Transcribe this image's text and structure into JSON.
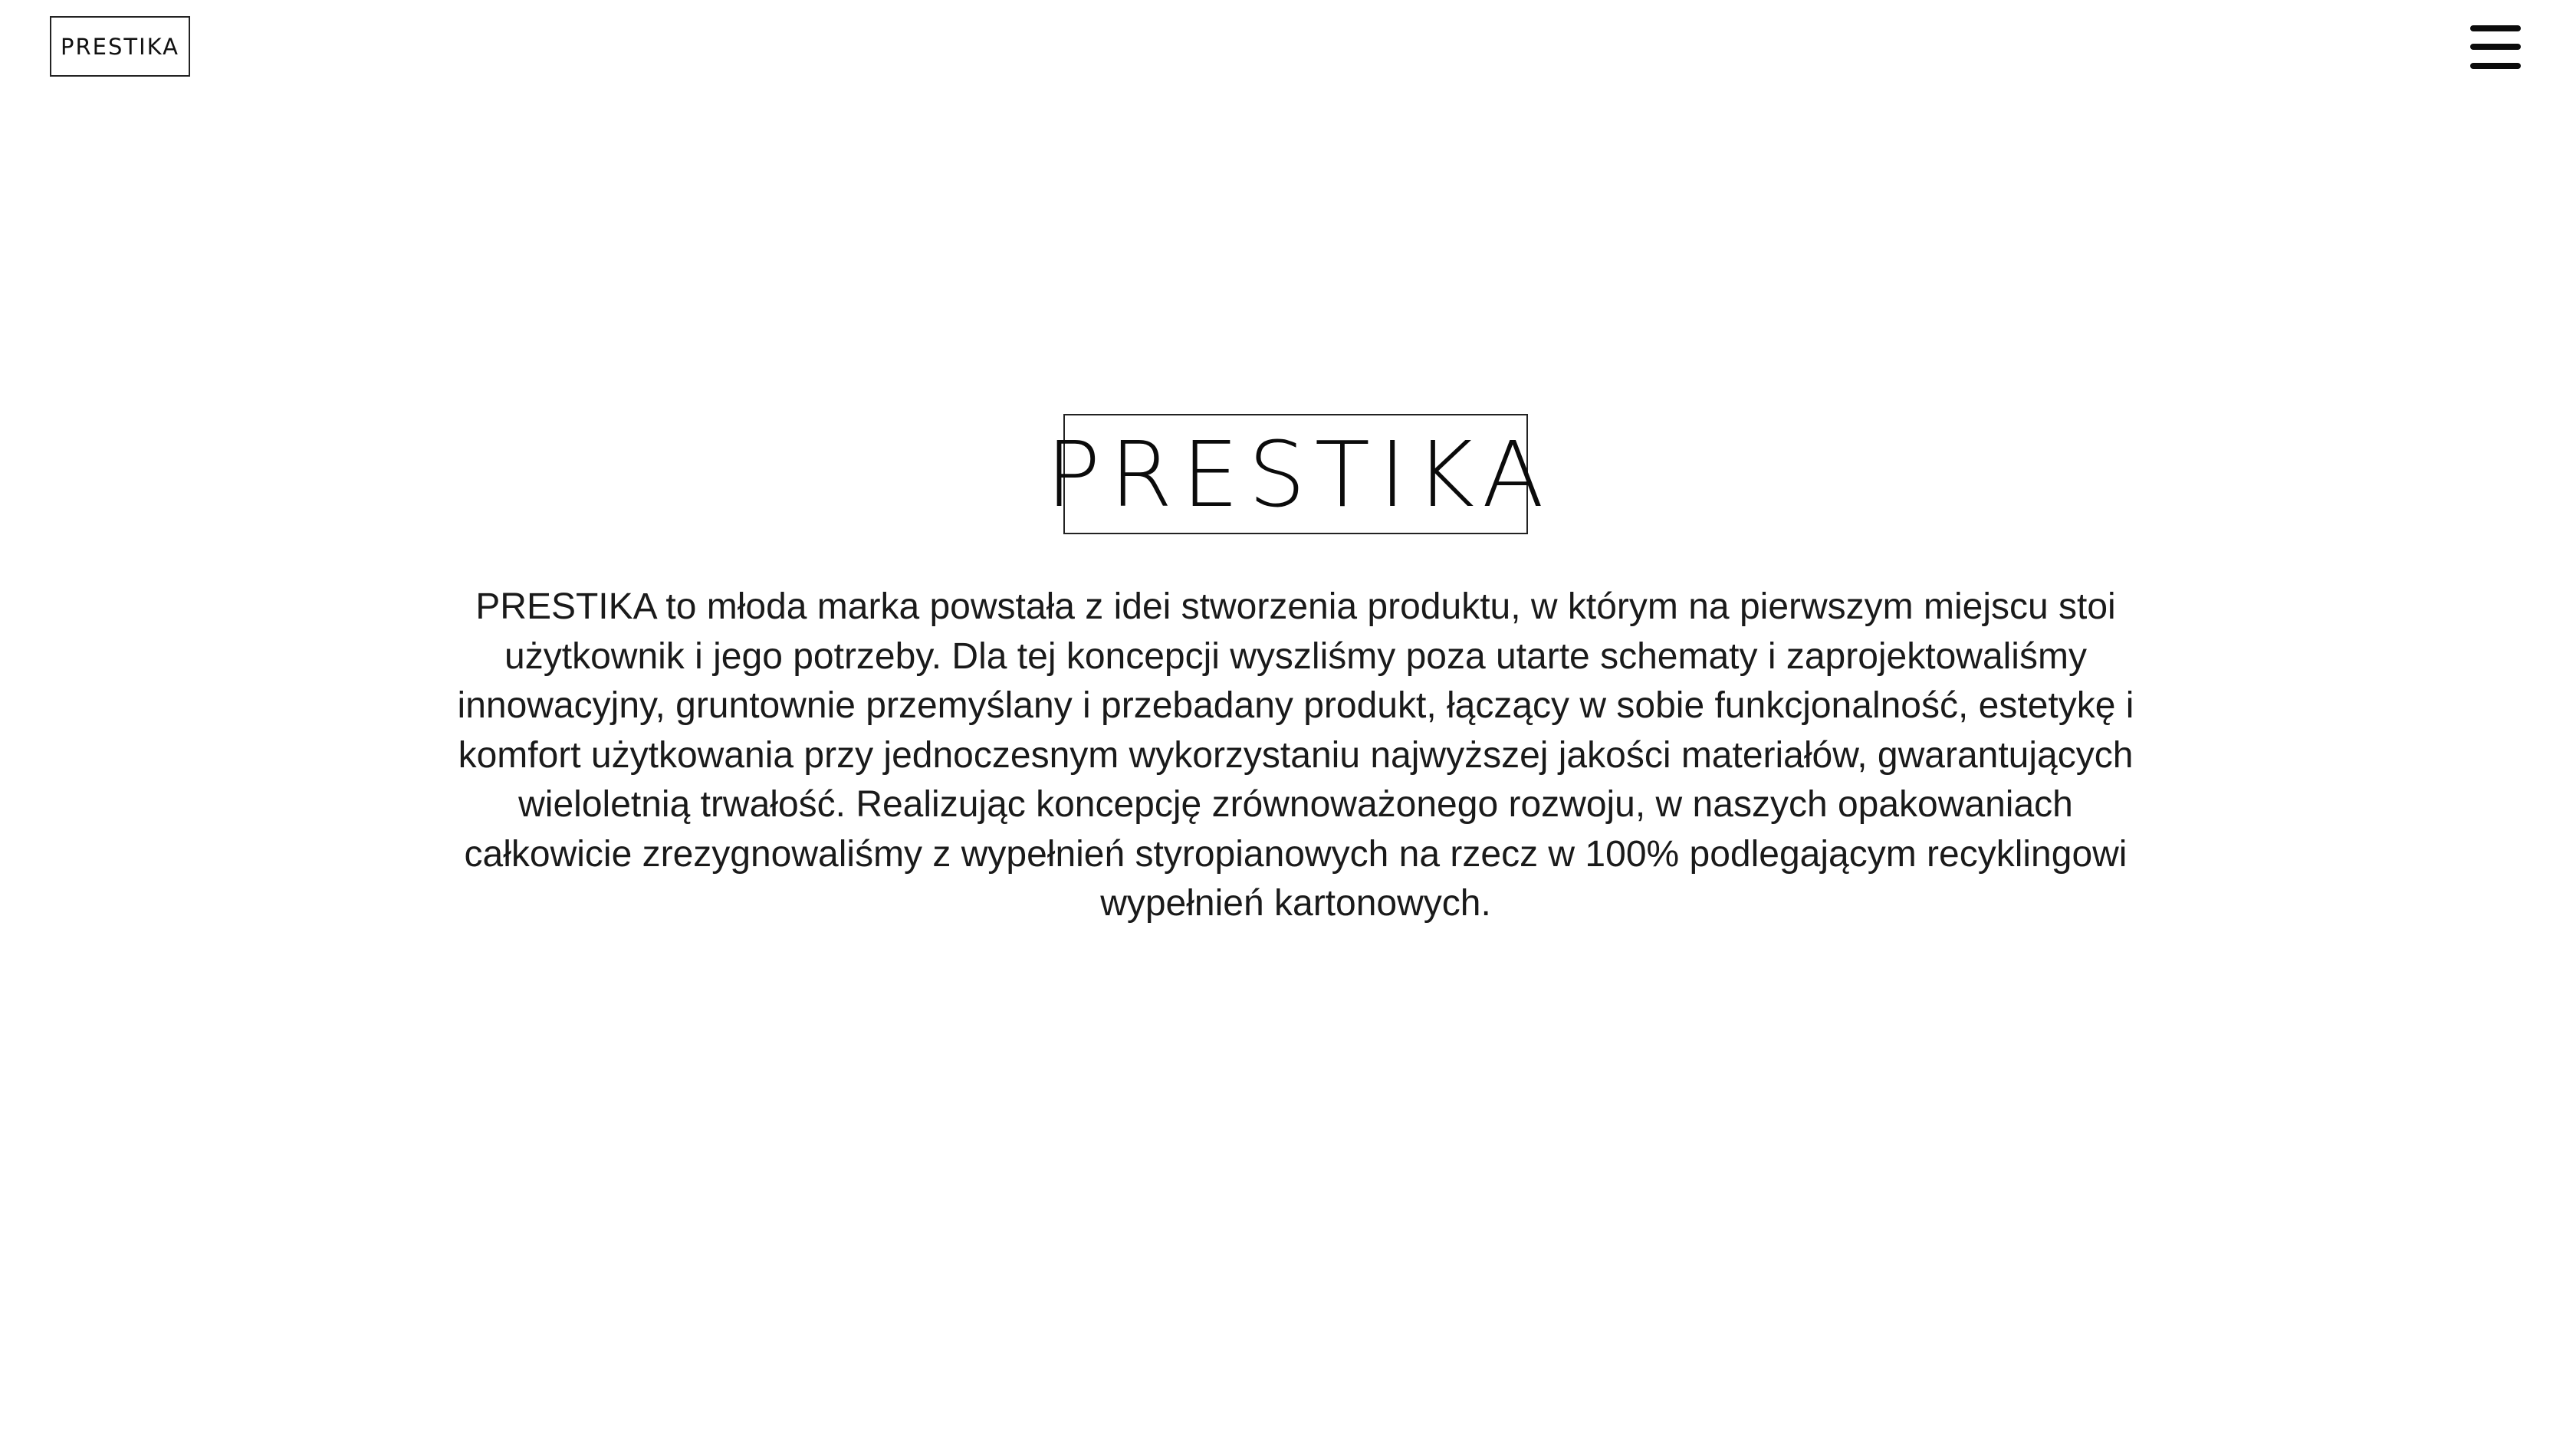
{
  "header": {
    "logo_text": "PRESTIKA",
    "menu_icon": "hamburger-menu-icon"
  },
  "hero": {
    "logo_text": "PRESTIKA",
    "description": "PRESTIKA to młoda marka powstała z idei stworzenia produktu, w którym na pierwszym miejscu stoi użytkownik i jego potrzeby. Dla tej koncepcji wyszliśmy poza utarte schematy i zaprojektowaliśmy innowacyjny, gruntownie przemyślany i przebadany produkt, łączący w sobie funkcjonalność, estetykę i komfort użytkowania przy jednoczesnym wykorzystaniu najwyższej jakości materiałów, gwarantujących wieloletnią trwałość. Realizując koncepcję zrównoważonego rozwoju, w naszych opakowaniach całkowicie zrezygnowaliśmy z wypełnień styropianowych na rzecz w 100% podlegającym recyklingowi wypełnień kartonowych."
  },
  "colors": {
    "background": "#ffffff",
    "text": "#111111",
    "border": "#222222"
  }
}
